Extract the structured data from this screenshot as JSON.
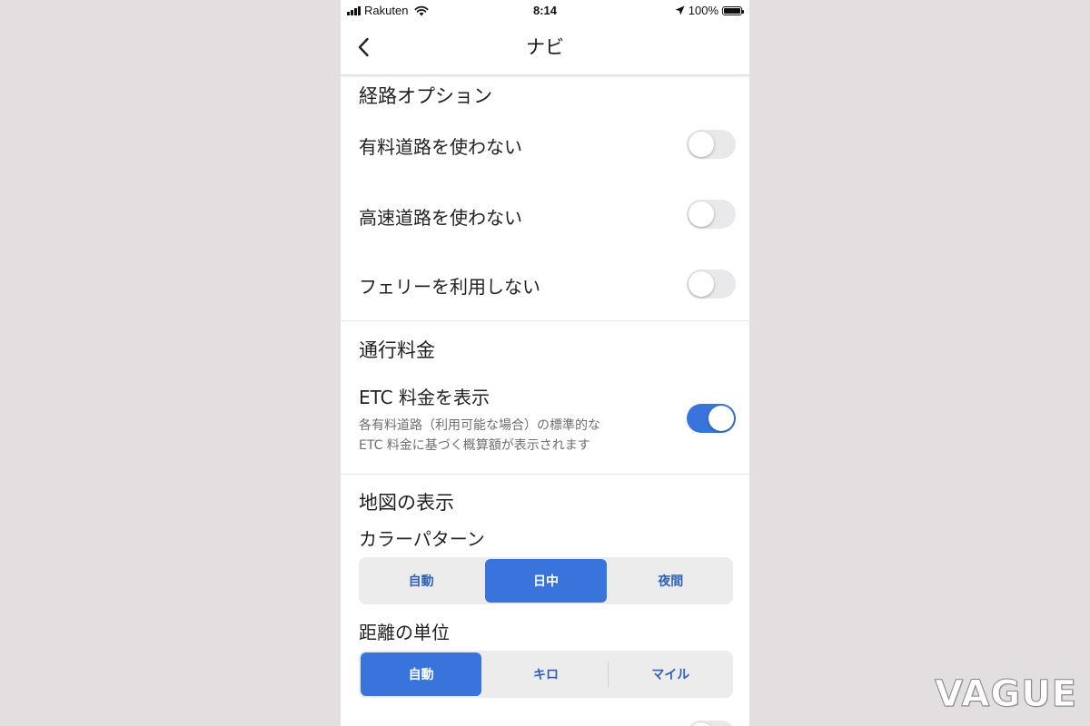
{
  "status_bar": {
    "carrier": "Rakuten",
    "time": "8:14",
    "battery": "100%",
    "battery_level": 1.0,
    "icons": [
      "signal-icon",
      "wifi-icon",
      "location-arrow-icon",
      "battery-icon"
    ]
  },
  "header": {
    "title": "ナビ",
    "back_icon": "chevron-left-icon"
  },
  "sections": {
    "route": {
      "title": "経路オプション",
      "items": [
        {
          "label": "有料道路を使わない",
          "enabled": false
        },
        {
          "label": "高速道路を使わない",
          "enabled": false
        },
        {
          "label": "フェリーを利用しない",
          "enabled": false
        }
      ]
    },
    "tolls": {
      "title": "通行料金",
      "item": {
        "label": "ETC 料金を表示",
        "desc_line1": "各有料道路（利用可能な場合）の標準的な",
        "desc_line2": "ETC 料金に基づく概算額が表示されます",
        "enabled": true
      }
    },
    "map": {
      "title": "地図の表示",
      "color_scheme": {
        "label": "カラーパターン",
        "options": [
          "自動",
          "日中",
          "夜間"
        ],
        "selected": "日中"
      },
      "distance_units": {
        "label": "距離の単位",
        "options": [
          "自動",
          "キロ",
          "マイル"
        ],
        "selected": "自動"
      }
    }
  },
  "colors": {
    "accent": "#3874db",
    "toggle_off": "#e9e9eb",
    "segment_bg": "#ececec",
    "backdrop": "#e3dfe0"
  },
  "watermark": "VAGUE"
}
